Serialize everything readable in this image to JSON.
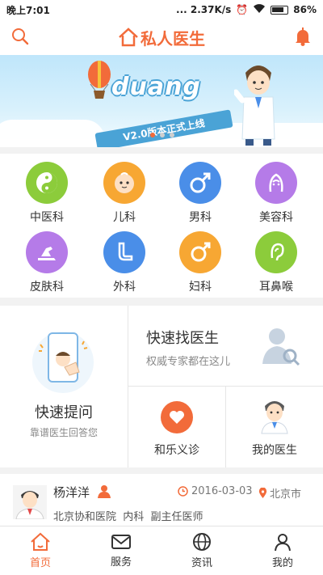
{
  "status": {
    "time": "晚上7:01",
    "network": "... 2.37K/s",
    "battery": "86%"
  },
  "header": {
    "logo_text": "私人医生"
  },
  "banner": {
    "headline": "duang",
    "ribbon": "V2.0版本正式上线"
  },
  "departments": [
    {
      "label": "中医科",
      "icon": "yin-yang-icon",
      "color": "#8ccc3b"
    },
    {
      "label": "儿科",
      "icon": "baby-face-icon",
      "color": "#f7a733"
    },
    {
      "label": "男科",
      "icon": "male-symbol-icon",
      "color": "#4a8ee8"
    },
    {
      "label": "美容科",
      "icon": "female-face-icon",
      "color": "#b57be8"
    },
    {
      "label": "皮肤科",
      "icon": "skin-hand-icon",
      "color": "#b57be8"
    },
    {
      "label": "外科",
      "icon": "leg-icon",
      "color": "#4a8ee8"
    },
    {
      "label": "妇科",
      "icon": "female-symbol-icon",
      "color": "#f7a733"
    },
    {
      "label": "耳鼻喉",
      "icon": "ear-icon",
      "color": "#8ccc3b"
    }
  ],
  "quick_ask": {
    "title": "快速提问",
    "subtitle": "靠谱医生回答您"
  },
  "find_doctor": {
    "title": "快速找医生",
    "subtitle": "权威专家都在这儿"
  },
  "clinic": {
    "label": "和乐义诊"
  },
  "my_doctor": {
    "label": "我的医生"
  },
  "doctor_item": {
    "name": "杨洋洋",
    "date": "2016-03-03",
    "city": "北京市",
    "hospital": "北京协和医院  内科  副主任医师"
  },
  "tabs": [
    {
      "label": "首页",
      "icon": "home-icon"
    },
    {
      "label": "服务",
      "icon": "mail-icon"
    },
    {
      "label": "资讯",
      "icon": "globe-icon"
    },
    {
      "label": "我的",
      "icon": "user-icon"
    }
  ],
  "colors": {
    "accent": "#f26b3a"
  }
}
